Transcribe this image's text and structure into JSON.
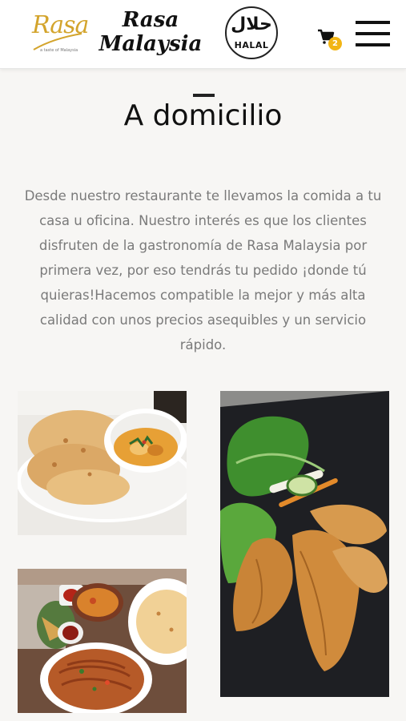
{
  "header": {
    "logo_script": "Rasa",
    "logo_tagline": "a taste of Malaysia",
    "brand_line1": "Rasa",
    "brand_line2": "Malaysia",
    "halal_arabic": "حلال",
    "halal_label": "HALAL",
    "cart_count": "2",
    "cart_icon": "cart-icon",
    "menu_icon": "hamburger-menu-icon"
  },
  "main": {
    "title": "A domicilio",
    "intro": "Desde nuestro restaurante te llevamos la comida a tu casa u oficina. Nuestro interés es que los clientes disfruten de la gastronomía de Rasa Malaysia por primera vez, por eso tendrás tu pedido ¡donde tú quieras!Hacemos compatible la mejor y más alta calidad con unos precios asequibles y un servicio rápido."
  },
  "colors": {
    "accent": "#f2b514",
    "logo_gold": "#d3a42c",
    "text_dark": "#111111",
    "text_muted": "#7a7a7a",
    "page_bg": "#f7f6f4"
  }
}
